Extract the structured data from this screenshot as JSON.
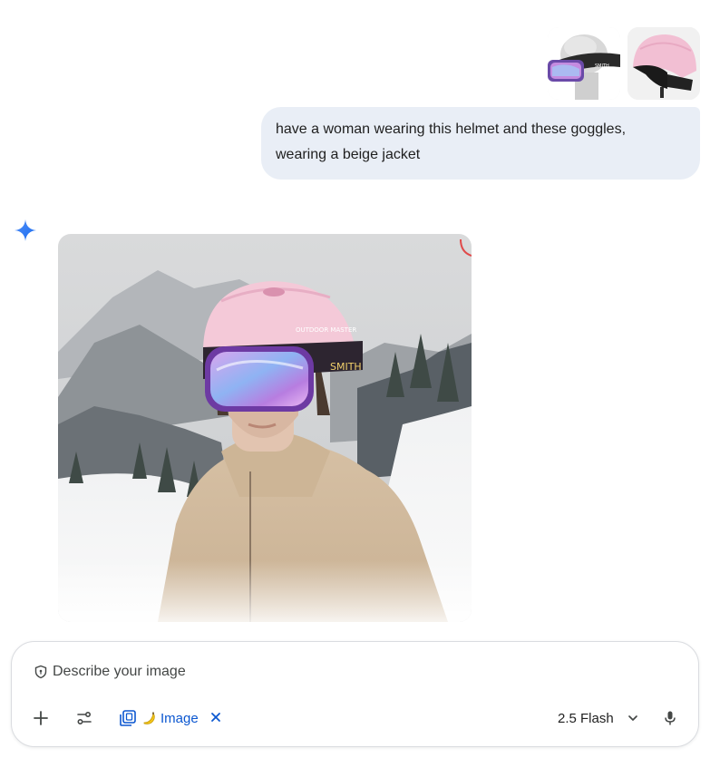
{
  "attachments": [
    {
      "icon": "goggles-on-mannequin-thumbnail"
    },
    {
      "icon": "pink-helmet-thumbnail"
    }
  ],
  "user_message": {
    "line1": "have a woman wearing this helmet and these goggles,",
    "line2": "wearing a beige jacket"
  },
  "assistant": {
    "icon": "gemini-sparkle-icon",
    "image": {
      "icon": "generated-image",
      "helmet_text": "OUTDOOR MASTER",
      "strap_text": "SMITH"
    }
  },
  "composer": {
    "placeholder": "Describe your image",
    "tool_chip_label": "Image",
    "model_label": "2.5 Flash",
    "icons": {
      "add": "plus-icon",
      "tools": "tune-icon",
      "chip": "image-stack-icon",
      "chip_emoji": "banana-emoji-icon",
      "close": "close-icon",
      "dropdown": "chevron-down-icon",
      "mic": "microphone-icon",
      "privacy": "shield-icon"
    },
    "accent_color": "#0b57d0"
  }
}
